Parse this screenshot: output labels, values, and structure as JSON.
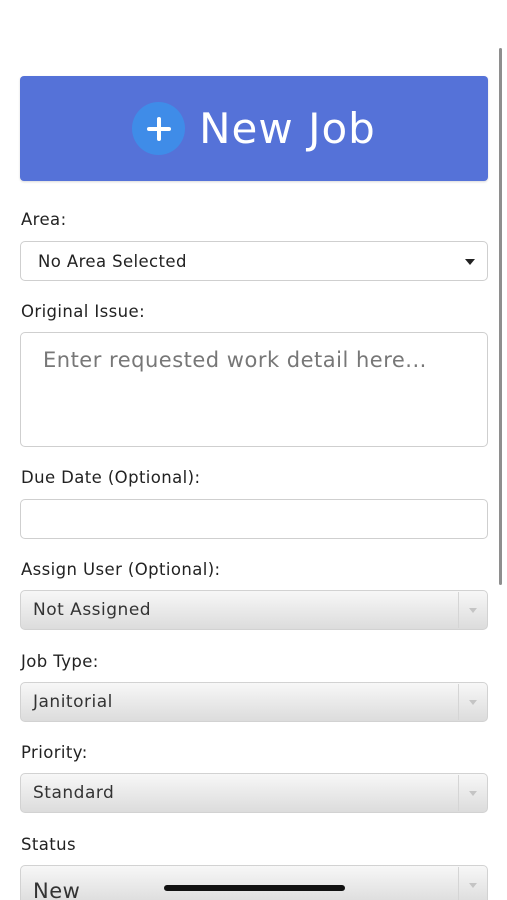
{
  "header": {
    "button_label": "New Job",
    "icon": "plus-circle-icon",
    "accent": "#5572d8"
  },
  "form": {
    "area": {
      "label": "Area:",
      "value": "No Area Selected"
    },
    "original_issue": {
      "label": "Original Issue:",
      "placeholder": "Enter requested work detail here..."
    },
    "due_date": {
      "label": "Due Date (Optional):",
      "value": ""
    },
    "assign_user": {
      "label": "Assign User (Optional):",
      "value": "Not Assigned"
    },
    "job_type": {
      "label": "Job Type:",
      "value": "Janitorial"
    },
    "priority": {
      "label": "Priority:",
      "value": "Standard"
    },
    "status": {
      "label": "Status",
      "value": "New"
    }
  }
}
